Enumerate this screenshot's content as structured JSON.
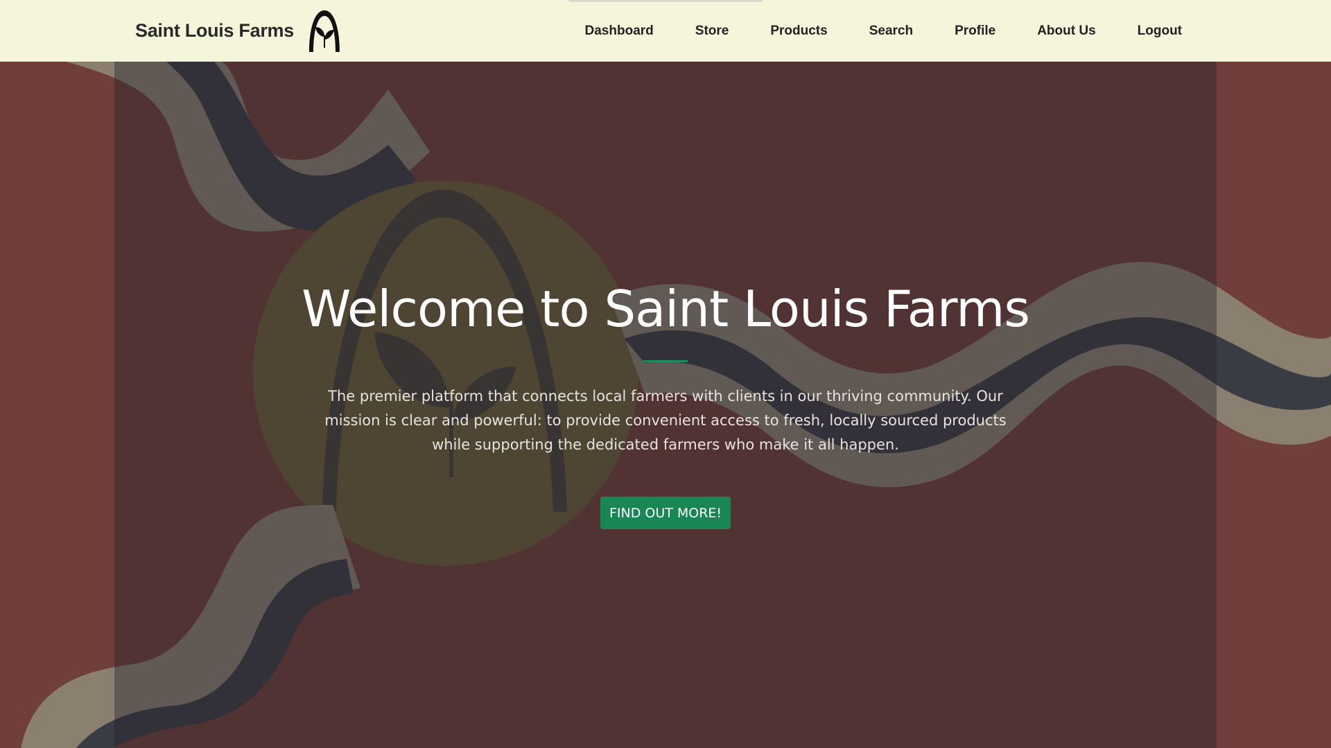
{
  "navbar": {
    "brand": "Saint Louis Farms",
    "brand_logo_icon": "arch-sprout-logo-icon",
    "links": [
      "Dashboard",
      "Store",
      "Products",
      "Search",
      "Profile",
      "About Us",
      "Logout"
    ]
  },
  "hero": {
    "title": "Welcome to Saint Louis Farms",
    "lead": "The premier platform that connects local farmers with clients in our thriving community. Our mission is clear and powerful: to provide convenient access to fresh, locally sourced products while supporting the dedicated farmers who make it all happen.",
    "cta_label": "FIND OUT MORE!",
    "background_icon": "saint-louis-flag-background"
  },
  "colors": {
    "navbar_bg": "#f4f5da",
    "flag_red": "#703f3c",
    "accent_green": "#198754",
    "title_color": "#ffffff"
  }
}
